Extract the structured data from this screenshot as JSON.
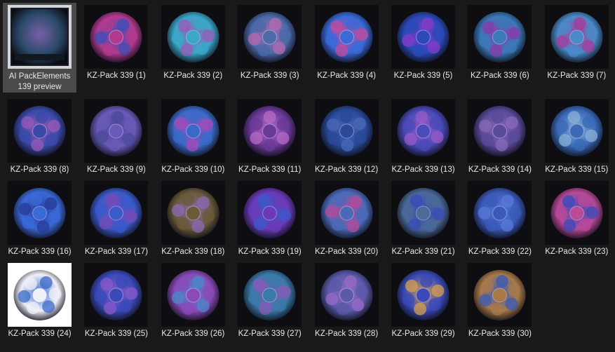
{
  "window": {
    "view_mode": "large-icons",
    "background": "#191919"
  },
  "selected_index": 0,
  "items": [
    {
      "label": "AI PackElements 139 preview",
      "icon": "preview-collage-icon",
      "colors": [
        "#2a4a6a",
        "#7a5fa8"
      ]
    },
    {
      "label": "KZ-Pack 339 (1)",
      "icon": "flower-wreath-icon",
      "colors": [
        "#b23a8e",
        "#3a4fb8"
      ]
    },
    {
      "label": "KZ-Pack 339 (2)",
      "icon": "lantern-icon",
      "colors": [
        "#3aa8c8",
        "#9a5ab8"
      ]
    },
    {
      "label": "KZ-Pack 339 (3)",
      "icon": "girl-in-hat-icon",
      "colors": [
        "#4a6aa8",
        "#b86ab0"
      ]
    },
    {
      "label": "KZ-Pack 339 (4)",
      "icon": "flower-bouquet-icon",
      "colors": [
        "#3a6ad8",
        "#c84a9a"
      ]
    },
    {
      "label": "KZ-Pack 339 (5)",
      "icon": "flower-branch-icon",
      "colors": [
        "#2a4ab8",
        "#8a3ac8"
      ]
    },
    {
      "label": "KZ-Pack 339 (6)",
      "icon": "potion-bottle-icon",
      "colors": [
        "#3a7ab8",
        "#8a3aa8"
      ]
    },
    {
      "label": "KZ-Pack 339 (7)",
      "icon": "potion-bottle-icon",
      "colors": [
        "#4a8ac8",
        "#a83a98"
      ]
    },
    {
      "label": "KZ-Pack 339 (8)",
      "icon": "fox-in-hat-icon",
      "colors": [
        "#3a4aa8",
        "#9a5ab8"
      ]
    },
    {
      "label": "KZ-Pack 339 (9)",
      "icon": "unicorn-icon",
      "colors": [
        "#6a5ab8",
        "#4a4a98"
      ]
    },
    {
      "label": "KZ-Pack 339 (10)",
      "icon": "hedgehog-icon",
      "colors": [
        "#3a6ac8",
        "#a84ab8"
      ]
    },
    {
      "label": "KZ-Pack 339 (11)",
      "icon": "crystal-logs-icon",
      "colors": [
        "#6a3a98",
        "#b86ac8"
      ]
    },
    {
      "label": "KZ-Pack 339 (12)",
      "icon": "squirrel-icon",
      "colors": [
        "#2a4a98",
        "#4a6ab8"
      ]
    },
    {
      "label": "KZ-Pack 339 (13)",
      "icon": "lotus-flower-icon",
      "colors": [
        "#4a4ab8",
        "#9a5ac8"
      ]
    },
    {
      "label": "KZ-Pack 339 (14)",
      "icon": "squirrel-curled-icon",
      "colors": [
        "#5a4a98",
        "#8a6ab8"
      ]
    },
    {
      "label": "KZ-Pack 339 (15)",
      "icon": "flower-cluster-icon",
      "colors": [
        "#3a6ab8",
        "#8ab0d8"
      ]
    },
    {
      "label": "KZ-Pack 339 (16)",
      "icon": "butterfly-icon",
      "colors": [
        "#3a6ad8",
        "#2a3a98"
      ]
    },
    {
      "label": "KZ-Pack 339 (17)",
      "icon": "caterpillar-icon",
      "colors": [
        "#3a5ac8",
        "#7a4ab8"
      ]
    },
    {
      "label": "KZ-Pack 339 (18)",
      "icon": "teapot-scene-icon",
      "colors": [
        "#6a5a3a",
        "#8a6ab8"
      ]
    },
    {
      "label": "KZ-Pack 339 (19)",
      "icon": "sunflower-icon",
      "colors": [
        "#6a3ab8",
        "#3a5ac8"
      ]
    },
    {
      "label": "KZ-Pack 339 (20)",
      "icon": "flower-face-icon",
      "colors": [
        "#4a6ab8",
        "#b84a98"
      ]
    },
    {
      "label": "KZ-Pack 339 (21)",
      "icon": "mouse-icon",
      "colors": [
        "#4a6a98",
        "#3a4ab8"
      ]
    },
    {
      "label": "KZ-Pack 339 (22)",
      "icon": "caterpillar-flower-icon",
      "colors": [
        "#3a5ab8",
        "#5a7ad8"
      ]
    },
    {
      "label": "KZ-Pack 339 (23)",
      "icon": "flower-basket-icon",
      "colors": [
        "#b84a98",
        "#3a4ab8"
      ]
    },
    {
      "label": "KZ-Pack 339 (24)",
      "icon": "teacup-icon",
      "colors": [
        "#f0f0f8",
        "#3a6ac8"
      ]
    },
    {
      "label": "KZ-Pack 339 (25)",
      "icon": "tree-house-icon",
      "colors": [
        "#3a4ab8",
        "#8a5ac8"
      ]
    },
    {
      "label": "KZ-Pack 339 (26)",
      "icon": "waterfall-icon",
      "colors": [
        "#8a4ab8",
        "#4a8ac8"
      ]
    },
    {
      "label": "KZ-Pack 339 (27)",
      "icon": "fairy-door-icon",
      "colors": [
        "#3a7aa8",
        "#8a5ab8"
      ]
    },
    {
      "label": "KZ-Pack 339 (28)",
      "icon": "fawn-icon",
      "colors": [
        "#5a5aa8",
        "#9a6ac8"
      ]
    },
    {
      "label": "KZ-Pack 339 (29)",
      "icon": "jar-icon",
      "colors": [
        "#3a4ab8",
        "#d8a04a"
      ]
    },
    {
      "label": "KZ-Pack 339 (30)",
      "icon": "puppy-icon",
      "colors": [
        "#a87a4a",
        "#3a5ab8"
      ]
    }
  ]
}
